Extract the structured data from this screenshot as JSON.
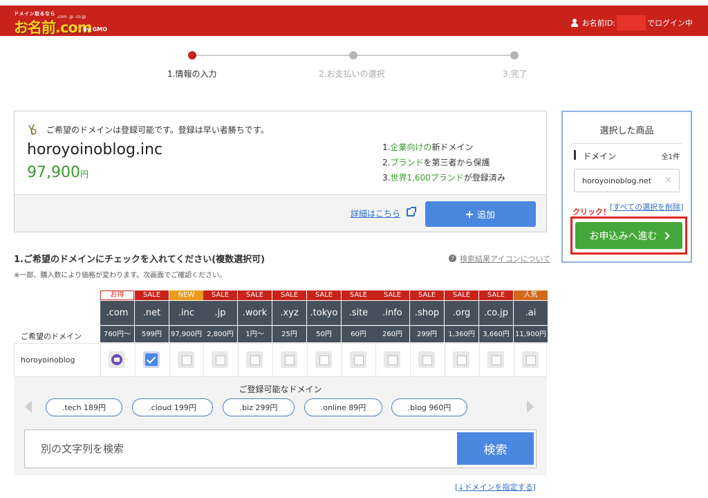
{
  "header": {
    "logo_tag": "ドメイン取るなら",
    "logo_sub": ".com .jp .co.jp",
    "logo_main": "お名前.com",
    "logo_gmo": "by GMO",
    "user_prefix": "お名前ID:",
    "user_suffix": "でログイン中"
  },
  "steps": [
    "1.情報の入力",
    "2.お支払いの選択",
    "3.完了"
  ],
  "card": {
    "available_msg": "ご希望のドメインは登録可能です。登録は早い者勝ちです。",
    "domain": "horoyoinoblog.inc",
    "price": "97,900",
    "price_unit": "円",
    "features": [
      {
        "pre": "1.",
        "hl": "企業向けの",
        "post": "新ドメイン"
      },
      {
        "pre": "2.",
        "hl": "ブランド",
        "post": "を第三者から保護"
      },
      {
        "pre": "3.",
        "hl": "世界1,600ブランド",
        "post": "が登録済み"
      }
    ],
    "detail_link": "詳細はこちら",
    "add_button": "追加"
  },
  "sidebar": {
    "title": "選択した商品",
    "section_label": "ドメイン",
    "count": "全1件",
    "item_name": "horoyoinoblog.net",
    "remove": "×",
    "click_label": "クリック！",
    "clear_open": "[",
    "clear_all": "すべての選択を削除",
    "clear_close": "]",
    "proceed_button": "お申込みへ進む"
  },
  "section": {
    "title": "1.ご希望のドメインにチェックを入れてください(複数選択可)",
    "note": "※一部、購入数により価格が変わります。次画面でご確認ください。",
    "help_icon": "?",
    "help_link": "検索結果アイコンについて"
  },
  "table": {
    "row_head": "ご希望のドメイン",
    "row_name": "horoyoinoblog",
    "tlds": [
      {
        "badge": "お得",
        "badge_color": "#ffffff",
        "name": ".com",
        "price": "760円〜",
        "state": "mail"
      },
      {
        "badge": "SALE",
        "badge_color": "#c8221a",
        "name": ".net",
        "price": "599円",
        "state": "checked"
      },
      {
        "badge": "NEW",
        "badge_color": "#e89b1f",
        "name": ".inc",
        "price": "97,900円",
        "state": "empty"
      },
      {
        "badge": "SALE",
        "badge_color": "#c8221a",
        "name": ".jp",
        "price": "2,800円",
        "state": "empty"
      },
      {
        "badge": "SALE",
        "badge_color": "#c8221a",
        "name": ".work",
        "price": "1円〜",
        "state": "empty"
      },
      {
        "badge": "SALE",
        "badge_color": "#c8221a",
        "name": ".xyz",
        "price": "25円",
        "state": "empty"
      },
      {
        "badge": "SALE",
        "badge_color": "#c8221a",
        "name": ".tokyo",
        "price": "50円",
        "state": "empty"
      },
      {
        "badge": "SALE",
        "badge_color": "#c8221a",
        "name": ".site",
        "price": "60円",
        "state": "empty"
      },
      {
        "badge": "SALE",
        "badge_color": "#c8221a",
        "name": ".info",
        "price": "260円",
        "state": "empty"
      },
      {
        "badge": "SALE",
        "badge_color": "#c8221a",
        "name": ".shop",
        "price": "299円",
        "state": "empty"
      },
      {
        "badge": "SALE",
        "badge_color": "#c8221a",
        "name": ".org",
        "price": "1,360円",
        "state": "empty"
      },
      {
        "badge": "SALE",
        "badge_color": "#c8221a",
        "name": ".co.jp",
        "price": "3,660円",
        "state": "empty"
      },
      {
        "badge": "人気",
        "badge_color": "#d2691e",
        "name": ".ai",
        "price": "11,900円",
        "state": "empty"
      }
    ]
  },
  "suggestions": {
    "title": "ご登録可能なドメイン",
    "chips": [
      ".tech 189円",
      ".cloud 199円",
      ".biz 299円",
      ".online 89円",
      ".blog 960円"
    ]
  },
  "search": {
    "placeholder": "別の文字列を検索",
    "button": "検索"
  },
  "spec_link": {
    "open": "[",
    "label": "↓ドメインを指定する",
    "close": "]"
  },
  "colors": {
    "header_red": "#c8221a",
    "accent_blue": "#4a87e0",
    "price_green": "#3a9a2e",
    "proceed_green": "#45a83a",
    "highlight_red": "#e0261d",
    "table_dark": "#46505c"
  }
}
